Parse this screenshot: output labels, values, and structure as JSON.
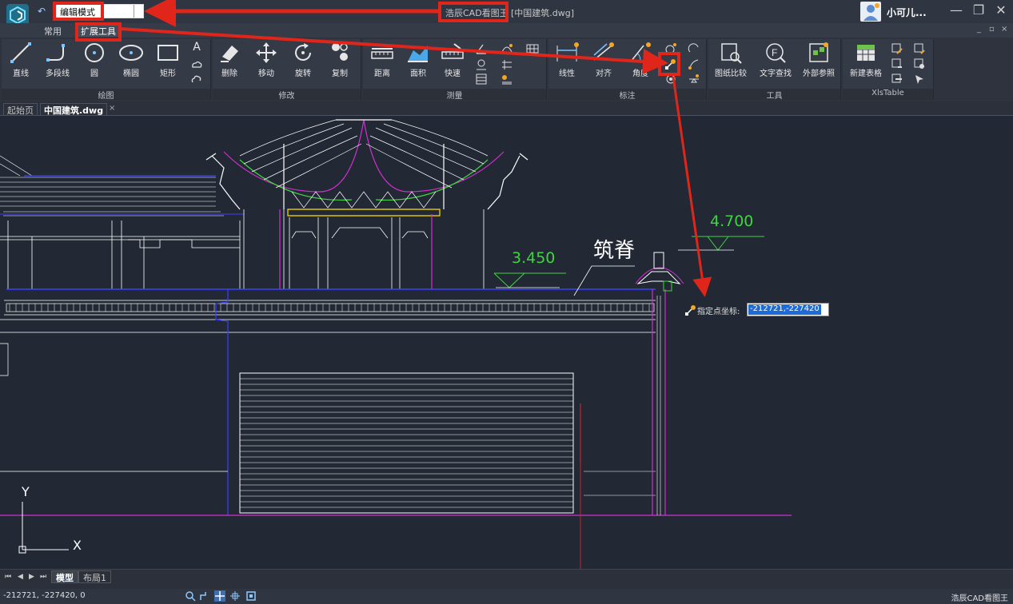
{
  "titlebar": {
    "mode": "编辑模式",
    "app_title": "浩辰CAD看图王",
    "doc_title": "[中国建筑.dwg]",
    "username": "小可儿..."
  },
  "ribbon_tabs": [
    "常用",
    "扩展工具"
  ],
  "groups": {
    "draw": {
      "title": "绘图",
      "line": "直线",
      "polyline": "多段线",
      "circle": "圆",
      "ellipse": "椭圆",
      "rect": "矩形",
      "text_icon": "A"
    },
    "modify": {
      "title": "修改",
      "erase": "删除",
      "move": "移动",
      "rotate": "旋转",
      "copy": "复制"
    },
    "measure": {
      "title": "测量",
      "distance": "距离",
      "area": "面积",
      "quick": "快速"
    },
    "dimension": {
      "title": "标注",
      "linear": "线性",
      "aligned": "对齐",
      "angle": "角度"
    },
    "tools": {
      "title": "工具",
      "compare": "图纸比较",
      "find_text": "文字查找",
      "xref": "外部参照"
    },
    "xls": {
      "title": "XlsTable",
      "new_table": "新建表格"
    }
  },
  "doc_tabs": [
    "起始页",
    "中国建筑.dwg"
  ],
  "drawing": {
    "level_1": "3.450",
    "level_2": "4.700",
    "note": "筑脊",
    "axis_y": "Y",
    "axis_x": "X"
  },
  "command": {
    "prompt": "指定点坐标:",
    "value": "-212721,-227420"
  },
  "layout_tabs": [
    "模型",
    "布局1"
  ],
  "status": {
    "coords": "-212721, -227420, 0",
    "app": "浩辰CAD看图王"
  },
  "colors": {
    "canvas_bg": "#222834",
    "annotation": "#e0251b",
    "green_text": "#3fd43f",
    "magenta": "#d030d0",
    "blue": "#3a40ff"
  }
}
